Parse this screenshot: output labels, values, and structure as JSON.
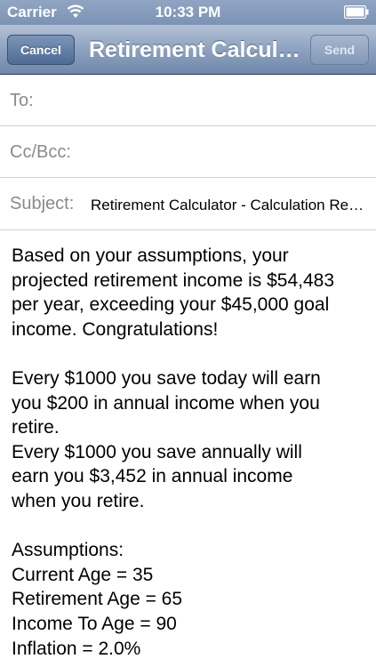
{
  "status": {
    "carrier": "Carrier",
    "time": "10:33 PM"
  },
  "nav": {
    "cancel_label": "Cancel",
    "title": "Retirement Calculator - Calculation Results",
    "send_label": "Send"
  },
  "fields": {
    "to_label": "To:",
    "cc_label": "Cc/Bcc:",
    "subject_label": "Subject:",
    "subject_value": "Retirement Calculator - Calculation Results"
  },
  "body": {
    "lines": [
      "Based on your assumptions, your",
      "projected retirement income is $54,483",
      "per year, exceeding your $45,000 goal",
      "income.  Congratulations!",
      "",
      "Every $1000 you save today will earn",
      "you $200 in annual income when you",
      "retire.",
      "Every $1000 you save annually will",
      "earn you $3,452 in annual income",
      "when you retire.",
      "",
      "Assumptions:",
      "Current Age = 35",
      "Retirement Age = 65",
      "Income To Age = 90",
      "Inflation = 2.0%"
    ]
  }
}
